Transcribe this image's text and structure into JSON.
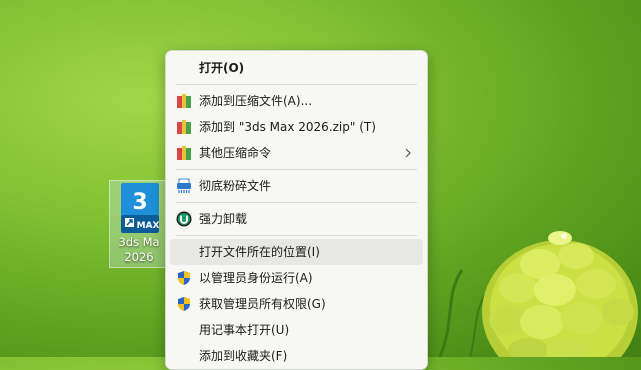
{
  "desktop": {
    "shortcut": {
      "badge_number": "3",
      "badge_text": "MAX",
      "label_line1": "3ds Ma",
      "label_line2": "2026",
      "icon": "3ds-max-app-icon"
    }
  },
  "context_menu": {
    "items": [
      {
        "label": "打开(O)",
        "icon": ""
      },
      {
        "label": "添加到压缩文件(A)...",
        "icon": "winrar-archive-icon"
      },
      {
        "label": "添加到 \"3ds Max 2026.zip\" (T)",
        "icon": "winrar-archive-icon"
      },
      {
        "label": "其他压缩命令",
        "icon": "winrar-archive-icon",
        "submenu_icon": "chevron-right-icon"
      },
      {
        "label": "彻底粉碎文件",
        "icon": "shredder-icon"
      },
      {
        "label": "强力卸载",
        "icon": "uninstall-icon"
      },
      {
        "label": "打开文件所在的位置(I)",
        "icon": ""
      },
      {
        "label": "以管理员身份运行(A)",
        "icon": "uac-shield-icon"
      },
      {
        "label": "获取管理员所有权限(G)",
        "icon": "uac-shield-icon"
      },
      {
        "label": "用记事本打开(U)",
        "icon": ""
      },
      {
        "label": "添加到收藏夹(F)",
        "icon": ""
      }
    ],
    "hovered_item": "打开文件所在的位置(I)"
  },
  "colors": {
    "desktop_green": "#84c334",
    "menu_background": "#f7f8f4",
    "hover": "#e7e8e4",
    "app_icon_blue": "#1e8fd8"
  }
}
